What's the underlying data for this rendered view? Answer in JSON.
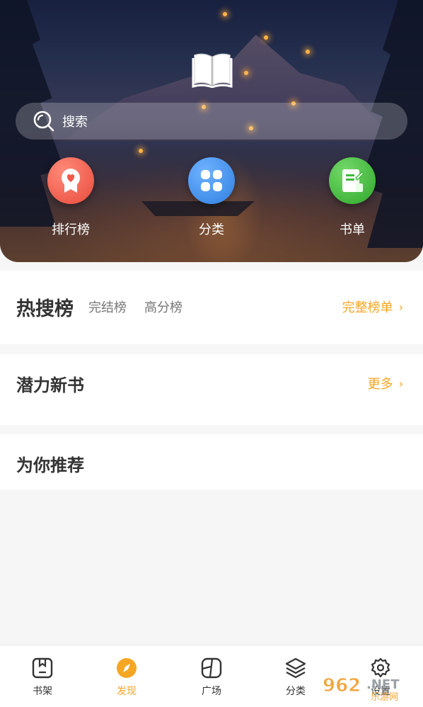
{
  "search": {
    "placeholder": "搜索"
  },
  "quick_actions": [
    {
      "label": "排行榜",
      "icon": "ribbon-heart-icon",
      "color": "#ef5a4a"
    },
    {
      "label": "分类",
      "icon": "four-squares-icon",
      "color": "#3f8de8"
    },
    {
      "label": "书单",
      "icon": "document-edit-icon",
      "color": "#3dbb3a"
    }
  ],
  "sections": {
    "hot": {
      "title": "热搜榜",
      "tabs": [
        "完结榜",
        "高分榜"
      ],
      "more": "完整榜单"
    },
    "potential": {
      "title": "潜力新书",
      "more": "更多"
    },
    "recommend": {
      "title": "为你推荐"
    }
  },
  "bottom_nav": [
    {
      "label": "书架",
      "icon": "bookshelf-icon",
      "active": false
    },
    {
      "label": "发现",
      "icon": "compass-icon",
      "active": true
    },
    {
      "label": "广场",
      "icon": "square-plaza-icon",
      "active": false
    },
    {
      "label": "分类",
      "icon": "layers-icon",
      "active": false
    },
    {
      "label": "设置",
      "icon": "gear-icon",
      "active": false
    }
  ],
  "watermark": {
    "text_top": "962",
    "text_net": "NET",
    "text_bottom": "乐游网"
  },
  "colors": {
    "accent": "#f5a623",
    "title": "#333333",
    "subtab": "#777777"
  }
}
